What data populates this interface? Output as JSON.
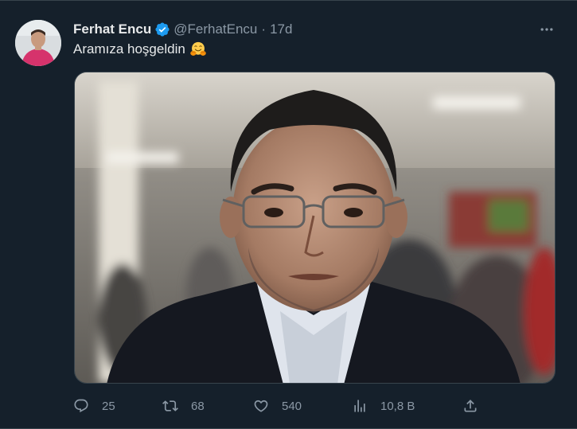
{
  "tweet": {
    "author_name": "Ferhat Encu",
    "handle": "@FerhatEncu",
    "separator": "·",
    "time": "17d",
    "text": "Aramıza hoşgeldin",
    "emoji": "hugging-face-emoji",
    "verified_color": "#1d9bf0"
  },
  "actions": {
    "replies": "25",
    "retweets": "68",
    "likes": "540",
    "views": "10,8 B"
  },
  "icons": {
    "more": "more-icon",
    "reply": "reply-icon",
    "retweet": "retweet-icon",
    "like": "heart-icon",
    "views": "bar-chart-icon",
    "share": "share-icon"
  },
  "colors": {
    "background": "#15202b",
    "text_primary": "#e7e9ea",
    "text_secondary": "#8b98a5",
    "border": "#38444d"
  }
}
